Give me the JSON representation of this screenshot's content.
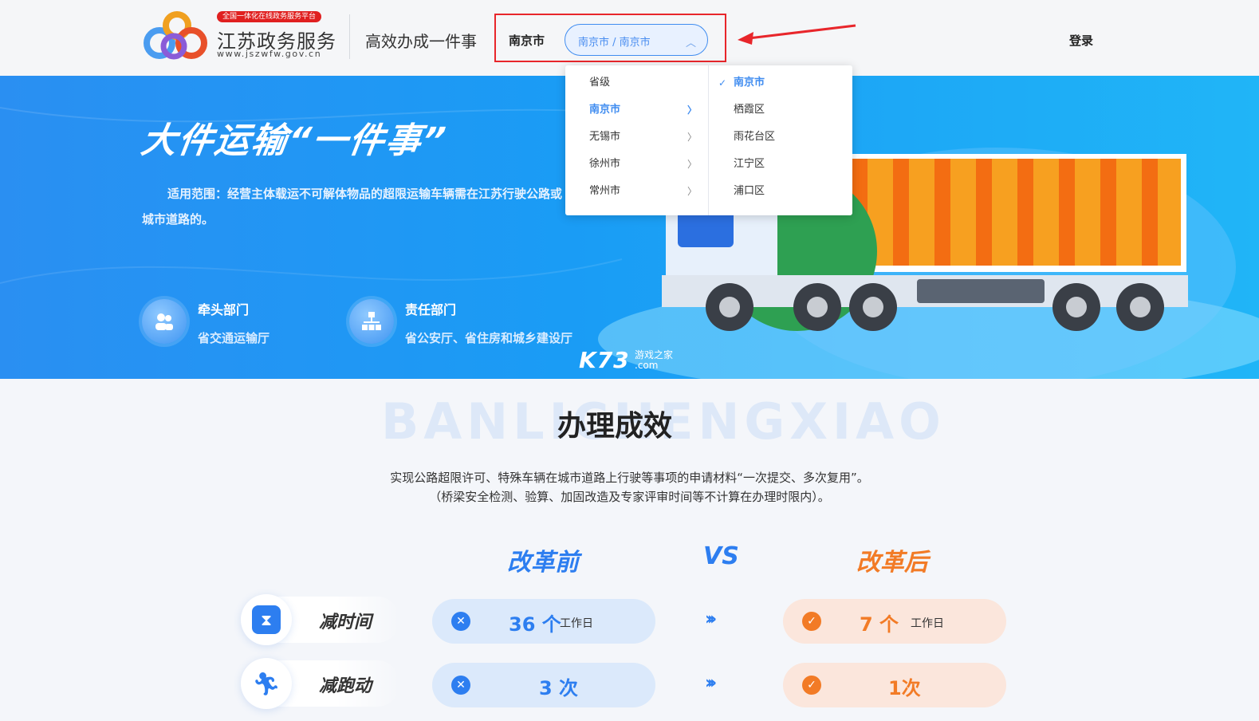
{
  "header": {
    "logo_badge": "全国一体化在线政务服务平台",
    "logo_title": "江苏政务服务",
    "logo_url": "www.jszwfw.gov.cn",
    "slogan": "高效办成一件事",
    "region_label": "南京市",
    "region_select_value": "南京市 / 南京市",
    "login": "登录"
  },
  "dropdown": {
    "left_items": [
      {
        "label": "省级",
        "has_children": false,
        "active": false
      },
      {
        "label": "南京市",
        "has_children": true,
        "active": true
      },
      {
        "label": "无锡市",
        "has_children": true,
        "active": false
      },
      {
        "label": "徐州市",
        "has_children": true,
        "active": false
      },
      {
        "label": "常州市",
        "has_children": true,
        "active": false
      }
    ],
    "right_items": [
      {
        "label": "南京市",
        "selected": true
      },
      {
        "label": "栖霞区",
        "selected": false
      },
      {
        "label": "雨花台区",
        "selected": false
      },
      {
        "label": "江宁区",
        "selected": false
      },
      {
        "label": "浦口区",
        "selected": false
      }
    ]
  },
  "banner": {
    "title": "大件运输“一件事”",
    "scope": "适用范围：经营主体载运不可解体物品的超限运输车辆需在江苏行驶公路或城市道路的。",
    "lead_dept_title": "牵头部门",
    "lead_dept_value": "省交通运输厅",
    "resp_dept_title": "责任部门",
    "resp_dept_value": "省公安厅、省住房和城乡建设厅",
    "watermark_big": "K73",
    "watermark_small_1": "游戏之家",
    "watermark_small_2": ".com"
  },
  "results": {
    "bg_text": "BANLICHENGXIAO",
    "title": "办理成效",
    "desc_line1": "实现公路超限许可、特殊车辆在城市道路上行驶等事项的申请材料“一次提交、多次复用”。",
    "desc_line2": "（桥梁安全检测、验算、加固改造及专家评审时间等不计算在办理时限内）。",
    "before_title": "改革前",
    "vs": "VS",
    "after_title": "改革后",
    "rows": [
      {
        "label": "减时间",
        "before_num": "36 个",
        "before_unit": "工作日",
        "after_num": "7 个",
        "after_unit": "工作日"
      },
      {
        "label": "减跑动",
        "before_num": "3 次",
        "before_unit": "",
        "after_num": "1次",
        "after_unit": ""
      }
    ]
  },
  "colors": {
    "accent_blue": "#2d7ef0",
    "accent_orange": "#f27b26",
    "highlight_red": "#e8262b"
  }
}
